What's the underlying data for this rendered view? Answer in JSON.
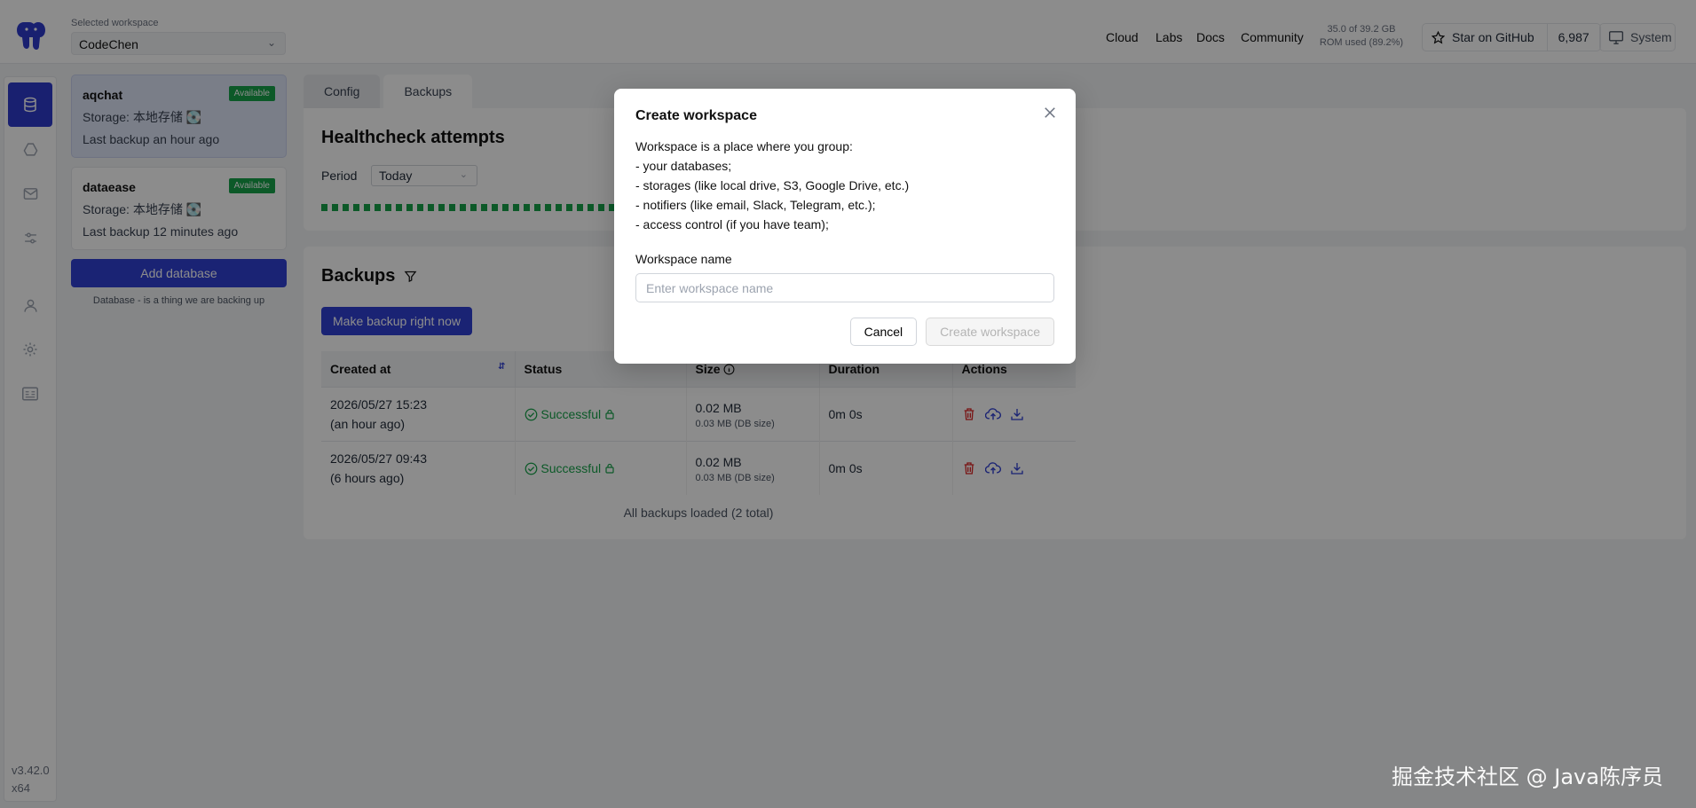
{
  "header": {
    "workspace_label": "Selected workspace",
    "workspace_value": "CodeChen",
    "nav": [
      "Cloud",
      "Labs",
      "Docs",
      "Community"
    ],
    "rom_line1": "35.0 of 39.2 GB",
    "rom_line2": "ROM used (89.2%)",
    "github_label": "Star on GitHub",
    "github_count": "6,987",
    "system_label": "System"
  },
  "sidebar": {
    "icons": [
      "database-icon",
      "storage-icon",
      "mail-icon",
      "sliders-icon",
      "user-icon",
      "gear-icon",
      "id-card-icon"
    ],
    "version_line1": "v3.42.0",
    "version_line2": "x64"
  },
  "databases": [
    {
      "name": "aqchat",
      "badge": "Available",
      "storage": "Storage: 本地存储 💽",
      "last_backup": "Last backup an hour ago"
    },
    {
      "name": "dataease",
      "badge": "Available",
      "storage": "Storage: 本地存储 💽",
      "last_backup": "Last backup 12 minutes ago"
    }
  ],
  "add_database_label": "Add database",
  "database_hint": "Database - is a thing we are backing up",
  "tabs": [
    "Config",
    "Backups"
  ],
  "healthcheck": {
    "title": "Healthcheck attempts",
    "period_label": "Period",
    "period_value": "Today",
    "ok_color": "#16a34a"
  },
  "backups": {
    "title": "Backups",
    "make_backup_label": "Make backup right now",
    "columns": [
      "Created at",
      "Status",
      "Size",
      "Duration",
      "Actions"
    ],
    "rows": [
      {
        "created": "2026/05/27 15:23",
        "relative": "(an hour ago)",
        "status": "Successful",
        "size": "0.02 MB",
        "db_size": "0.03 MB (DB size)",
        "duration": "0m 0s"
      },
      {
        "created": "2026/05/27 09:43",
        "relative": "(6 hours ago)",
        "status": "Successful",
        "size": "0.02 MB",
        "db_size": "0.03 MB (DB size)",
        "duration": "0m 0s"
      }
    ],
    "footer": "All backups loaded (2 total)"
  },
  "modal": {
    "title": "Create workspace",
    "desc_line1": "Workspace is a place where you group:",
    "desc_line2": "- your databases;",
    "desc_line3": "- storages (like local drive, S3, Google Drive, etc.)",
    "desc_line4": "- notifiers (like email, Slack, Telegram, etc.);",
    "desc_line5": "- access control (if you have team);",
    "field_label": "Workspace name",
    "field_placeholder": "Enter workspace name",
    "field_value": "",
    "cancel_label": "Cancel",
    "create_label": "Create workspace"
  },
  "watermark": "掘金技术社区 @ Java陈序员",
  "colors": {
    "primary": "#3140d3",
    "success": "#16a34a",
    "danger": "#dc2626"
  }
}
